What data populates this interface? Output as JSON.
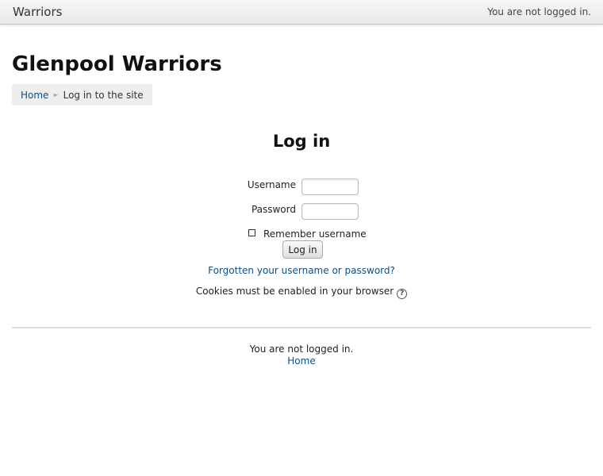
{
  "navbar": {
    "brand": "Warriors",
    "login_info": "You are not logged in."
  },
  "page": {
    "site_title": "Glenpool Warriors"
  },
  "breadcrumb": {
    "home": "Home",
    "current": "Log in to the site",
    "separator": "►"
  },
  "login": {
    "heading": "Log in",
    "username_label": "Username",
    "username_value": "",
    "password_label": "Password",
    "password_value": "",
    "remember_label": "Remember username",
    "remember_checked": false,
    "submit_label": "Log in",
    "forgot_link": "Forgotten your username or password?",
    "cookies_text": "Cookies must be enabled in your browser",
    "help_icon": "?"
  },
  "footer": {
    "login_info": "You are not logged in.",
    "home_link": "Home"
  },
  "colors": {
    "link": "#0a4f8a",
    "breadcrumb_bg": "#eeeeee",
    "navbar_bg": "#efefef"
  }
}
